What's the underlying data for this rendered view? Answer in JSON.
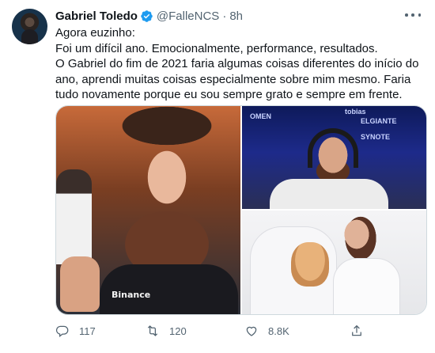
{
  "tweet": {
    "author_name": "Gabriel Toledo",
    "handle": "@FalleNCS",
    "separator": "·",
    "timestamp": "8h",
    "verified_color": "#1d9bf0",
    "lines": [
      "Agora euzinho:",
      "Foi um difícil ano. Emocionalmente, performance, resultados.",
      "O Gabriel do fim de 2021 faria algumas coisas diferentes do início do ano, aprendi muitas coisas especialmente sobre mim mesmo. Faria tudo novamente porque eu sou sempre grato e sempre em frente."
    ],
    "photos": {
      "main_sponsor": "Binance",
      "top_right_banners": [
        "OMEN",
        "ELGIANTE",
        "tobias",
        "SYNOTE"
      ]
    },
    "actions": {
      "reply_icon": "reply-icon",
      "reply_count": "117",
      "retweet_icon": "retweet-icon",
      "retweet_count": "120",
      "like_icon": "like-icon",
      "like_count": "8.8K",
      "share_icon": "share-icon"
    }
  }
}
